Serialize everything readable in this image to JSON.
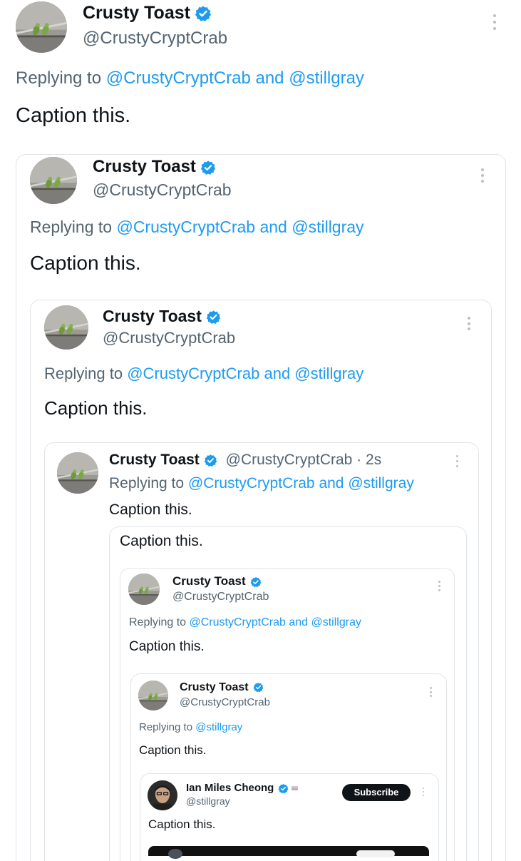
{
  "tweets": [
    {
      "name": "Crusty Toast",
      "handle": "@CrustyCryptCrab",
      "replying_prefix": "Replying to",
      "replying_to_1": "@CrustyCryptCrab",
      "replying_and": "and",
      "replying_to_2": "@stillgray",
      "text": "Caption this."
    },
    {
      "name": "Crusty Toast",
      "handle": "@CrustyCryptCrab",
      "replying_prefix": "Replying to",
      "replying_to_1": "@CrustyCryptCrab",
      "replying_and": "and",
      "replying_to_2": "@stillgray",
      "text": "Caption this."
    },
    {
      "name": "Crusty Toast",
      "handle": "@CrustyCryptCrab",
      "replying_prefix": "Replying to",
      "replying_to_1": "@CrustyCryptCrab",
      "replying_and": "and",
      "replying_to_2": "@stillgray",
      "text": "Caption this."
    },
    {
      "name": "Crusty Toast",
      "handle": "@CrustyCryptCrab",
      "timestamp": "· 2s",
      "replying_prefix": "Replying to",
      "replying_to_1": "@CrustyCryptCrab",
      "replying_and": "and",
      "replying_to_2": "@stillgray",
      "text": "Caption this."
    },
    {
      "text": "Caption this."
    },
    {
      "name": "Crusty Toast",
      "handle": "@CrustyCryptCrab",
      "replying_prefix": "Replying to",
      "replying_to_1": "@CrustyCryptCrab",
      "replying_and": "and",
      "replying_to_2": "@stillgray",
      "text": "Caption this."
    },
    {
      "name": "Crusty Toast",
      "handle": "@CrustyCryptCrab",
      "replying_prefix": "Replying to",
      "replying_to_1": "@stillgray",
      "text": "Caption this."
    },
    {
      "name": "Ian Miles Cheong",
      "handle": "@stillgray",
      "subscribe_label": "Subscribe",
      "text": "Caption this."
    }
  ],
  "colors": {
    "link": "#1d9bf0",
    "verified": "#1d9bf0",
    "muted": "#536471",
    "text": "#0f1419",
    "border": "#e1e4e8"
  },
  "icons": {
    "verified": "verified-badge-icon",
    "more": "more-options-icon",
    "flag": "flag-icon"
  }
}
